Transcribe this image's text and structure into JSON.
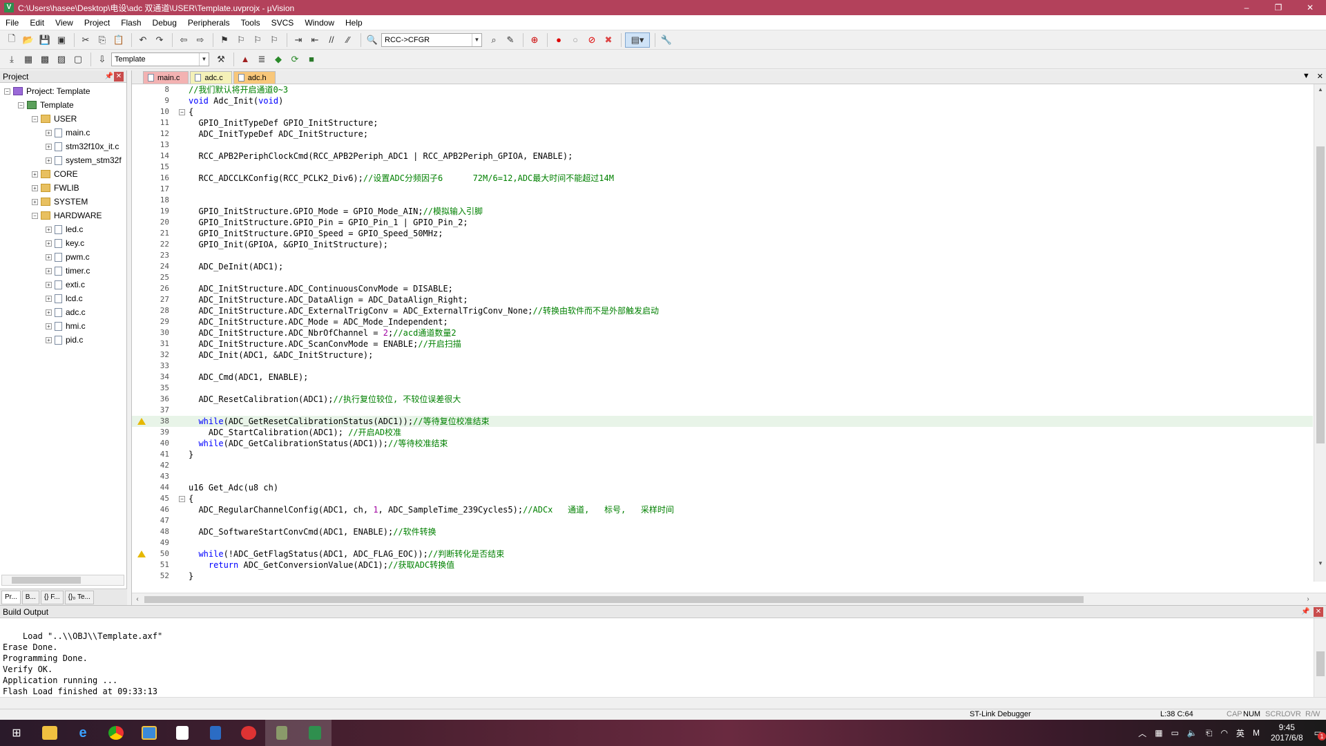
{
  "window": {
    "title": "C:\\Users\\hasee\\Desktop\\电设\\adc 双通道\\USER\\Template.uvprojx - µVision",
    "minimize": "–",
    "restore": "❐",
    "close": "✕"
  },
  "menu": [
    "File",
    "Edit",
    "View",
    "Project",
    "Flash",
    "Debug",
    "Peripherals",
    "Tools",
    "SVCS",
    "Window",
    "Help"
  ],
  "toolbar": {
    "function_combo": "RCC->CFGR",
    "target_combo": "Template"
  },
  "project_panel": {
    "title": "Project",
    "tree": [
      {
        "level": 0,
        "label": "Project: Template",
        "icon": "project-icon",
        "expanded": true
      },
      {
        "level": 1,
        "label": "Template",
        "icon": "target-icon",
        "expanded": true
      },
      {
        "level": 2,
        "label": "USER",
        "icon": "folder-icon",
        "expanded": true
      },
      {
        "level": 3,
        "label": "main.c",
        "icon": "file-icon",
        "expanded": false
      },
      {
        "level": 3,
        "label": "stm32f10x_it.c",
        "icon": "file-icon",
        "expanded": false
      },
      {
        "level": 3,
        "label": "system_stm32f",
        "icon": "file-icon",
        "expanded": false
      },
      {
        "level": 2,
        "label": "CORE",
        "icon": "folder-icon",
        "expanded": false
      },
      {
        "level": 2,
        "label": "FWLIB",
        "icon": "folder-icon",
        "expanded": false
      },
      {
        "level": 2,
        "label": "SYSTEM",
        "icon": "folder-icon",
        "expanded": false
      },
      {
        "level": 2,
        "label": "HARDWARE",
        "icon": "folder-icon",
        "expanded": true
      },
      {
        "level": 3,
        "label": "led.c",
        "icon": "file-icon",
        "expanded": false
      },
      {
        "level": 3,
        "label": "key.c",
        "icon": "file-icon",
        "expanded": false
      },
      {
        "level": 3,
        "label": "pwm.c",
        "icon": "file-icon",
        "expanded": false
      },
      {
        "level": 3,
        "label": "timer.c",
        "icon": "file-icon",
        "expanded": false
      },
      {
        "level": 3,
        "label": "exti.c",
        "icon": "file-icon",
        "expanded": false
      },
      {
        "level": 3,
        "label": "lcd.c",
        "icon": "file-icon",
        "expanded": false
      },
      {
        "level": 3,
        "label": "adc.c",
        "icon": "file-icon",
        "expanded": false
      },
      {
        "level": 3,
        "label": "hmi.c",
        "icon": "file-icon",
        "expanded": false
      },
      {
        "level": 3,
        "label": "pid.c",
        "icon": "file-icon",
        "expanded": false
      }
    ],
    "tabs": [
      "Pr...",
      "B...",
      "{} F...",
      "{}₀ Te..."
    ]
  },
  "editor": {
    "tabs": [
      {
        "label": "main.c",
        "style": "main"
      },
      {
        "label": "adc.c",
        "style": "adcc"
      },
      {
        "label": "adc.h",
        "style": "adch"
      }
    ],
    "active_tab": "adc.c",
    "current_line": 38,
    "lines": [
      {
        "n": "8",
        "html": "<span class=\"cm\">//我们默认将开启通道0~3</span>"
      },
      {
        "n": "9",
        "html": "<span class=\"kw\">void</span> Adc_Init(<span class=\"kw\">void</span>)"
      },
      {
        "n": "10",
        "html": "{",
        "fold": true
      },
      {
        "n": "11",
        "html": "  GPIO_InitTypeDef GPIO_InitStructure;"
      },
      {
        "n": "12",
        "html": "  ADC_InitTypeDef ADC_InitStructure;"
      },
      {
        "n": "13",
        "html": ""
      },
      {
        "n": "14",
        "html": "  RCC_APB2PeriphClockCmd(RCC_APB2Periph_ADC1 | RCC_APB2Periph_GPIOA, ENABLE);"
      },
      {
        "n": "15",
        "html": ""
      },
      {
        "n": "16",
        "html": "  RCC_ADCCLKConfig(RCC_PCLK2_Div6);<span class=\"cm\">//设置ADC分频因子6      72M/6=12,ADC最大时间不能超过14M</span>"
      },
      {
        "n": "17",
        "html": ""
      },
      {
        "n": "18",
        "html": ""
      },
      {
        "n": "19",
        "html": "  GPIO_InitStructure.GPIO_Mode = GPIO_Mode_AIN;<span class=\"cm\">//模拟输入引脚</span>"
      },
      {
        "n": "20",
        "html": "  GPIO_InitStructure.GPIO_Pin = GPIO_Pin_1 | GPIO_Pin_2;"
      },
      {
        "n": "21",
        "html": "  GPIO_InitStructure.GPIO_Speed = GPIO_Speed_50MHz;"
      },
      {
        "n": "22",
        "html": "  GPIO_Init(GPIOA, &amp;GPIO_InitStructure);"
      },
      {
        "n": "23",
        "html": ""
      },
      {
        "n": "24",
        "html": "  ADC_DeInit(ADC1);"
      },
      {
        "n": "25",
        "html": ""
      },
      {
        "n": "26",
        "html": "  ADC_InitStructure.ADC_ContinuousConvMode = DISABLE;"
      },
      {
        "n": "27",
        "html": "  ADC_InitStructure.ADC_DataAlign = ADC_DataAlign_Right;"
      },
      {
        "n": "28",
        "html": "  ADC_InitStructure.ADC_ExternalTrigConv = ADC_ExternalTrigConv_None;<span class=\"cm\">//转换由软件而不是外部触发启动</span>"
      },
      {
        "n": "29",
        "html": "  ADC_InitStructure.ADC_Mode = ADC_Mode_Independent;"
      },
      {
        "n": "30",
        "html": "  ADC_InitStructure.ADC_NbrOfChannel = <span class=\"nm\">2</span>;<span class=\"cm\">//acd通道数量2</span>"
      },
      {
        "n": "31",
        "html": "  ADC_InitStructure.ADC_ScanConvMode = ENABLE;<span class=\"cm\">//开启扫描</span>"
      },
      {
        "n": "32",
        "html": "  ADC_Init(ADC1, &amp;ADC_InitStructure);"
      },
      {
        "n": "33",
        "html": ""
      },
      {
        "n": "34",
        "html": "  ADC_Cmd(ADC1, ENABLE);"
      },
      {
        "n": "35",
        "html": ""
      },
      {
        "n": "36",
        "html": "  ADC_ResetCalibration(ADC1);<span class=\"cm\">//执行复位较位, 不较位误差很大</span>"
      },
      {
        "n": "37",
        "html": ""
      },
      {
        "n": "38",
        "html": "  <span class=\"kw\">while</span>(ADC_GetResetCalibrationStatus(ADC1));<span class=\"cm\">//等待复位校准结束</span>",
        "warn": true
      },
      {
        "n": "39",
        "html": "    ADC_StartCalibration(ADC1); <span class=\"cm\">//开启AD校准</span>"
      },
      {
        "n": "40",
        "html": "  <span class=\"kw\">while</span>(ADC_GetCalibrationStatus(ADC1));<span class=\"cm\">//等待校准结束</span>"
      },
      {
        "n": "41",
        "html": "}"
      },
      {
        "n": "42",
        "html": ""
      },
      {
        "n": "43",
        "html": ""
      },
      {
        "n": "44",
        "html": "u16 Get_Adc(u8 ch)"
      },
      {
        "n": "45",
        "html": "{",
        "fold": true
      },
      {
        "n": "46",
        "html": "  ADC_RegularChannelConfig(ADC1, ch, <span class=\"nm\">1</span>, ADC_SampleTime_239Cycles5);<span class=\"cm\">//ADCx   通道,   标号,   采样时间</span>"
      },
      {
        "n": "47",
        "html": ""
      },
      {
        "n": "48",
        "html": "  ADC_SoftwareStartConvCmd(ADC1, ENABLE);<span class=\"cm\">//软件转换</span>"
      },
      {
        "n": "49",
        "html": ""
      },
      {
        "n": "50",
        "html": "  <span class=\"kw\">while</span>(!ADC_GetFlagStatus(ADC1, ADC_FLAG_EOC));<span class=\"cm\">//判断转化是否结束</span>",
        "warn": true
      },
      {
        "n": "51",
        "html": "    <span class=\"kw\">return</span> ADC_GetConversionValue(ADC1);<span class=\"cm\">//获取ADC转换值</span>"
      },
      {
        "n": "52",
        "html": "}"
      }
    ]
  },
  "build_output": {
    "title": "Build Output",
    "text": "Load \"..\\\\OBJ\\\\Template.axf\"\nErase Done.\nProgramming Done.\nVerify OK.\nApplication running ...\nFlash Load finished at 09:33:13"
  },
  "status": {
    "debugger": "ST-Link Debugger",
    "position": "L:38 C:64",
    "cap": "CAP",
    "num": "NUM",
    "scrl": "SCRL",
    "ovr": "OVR",
    "rw": "R/W"
  },
  "taskbar": {
    "time": "9:45",
    "date": "2017/6/8",
    "ime": "英",
    "ime2": "M",
    "notification_count": "1"
  },
  "colors": {
    "titlebar": "#b3415b",
    "keyword": "#0000ff",
    "comment": "#008000"
  }
}
